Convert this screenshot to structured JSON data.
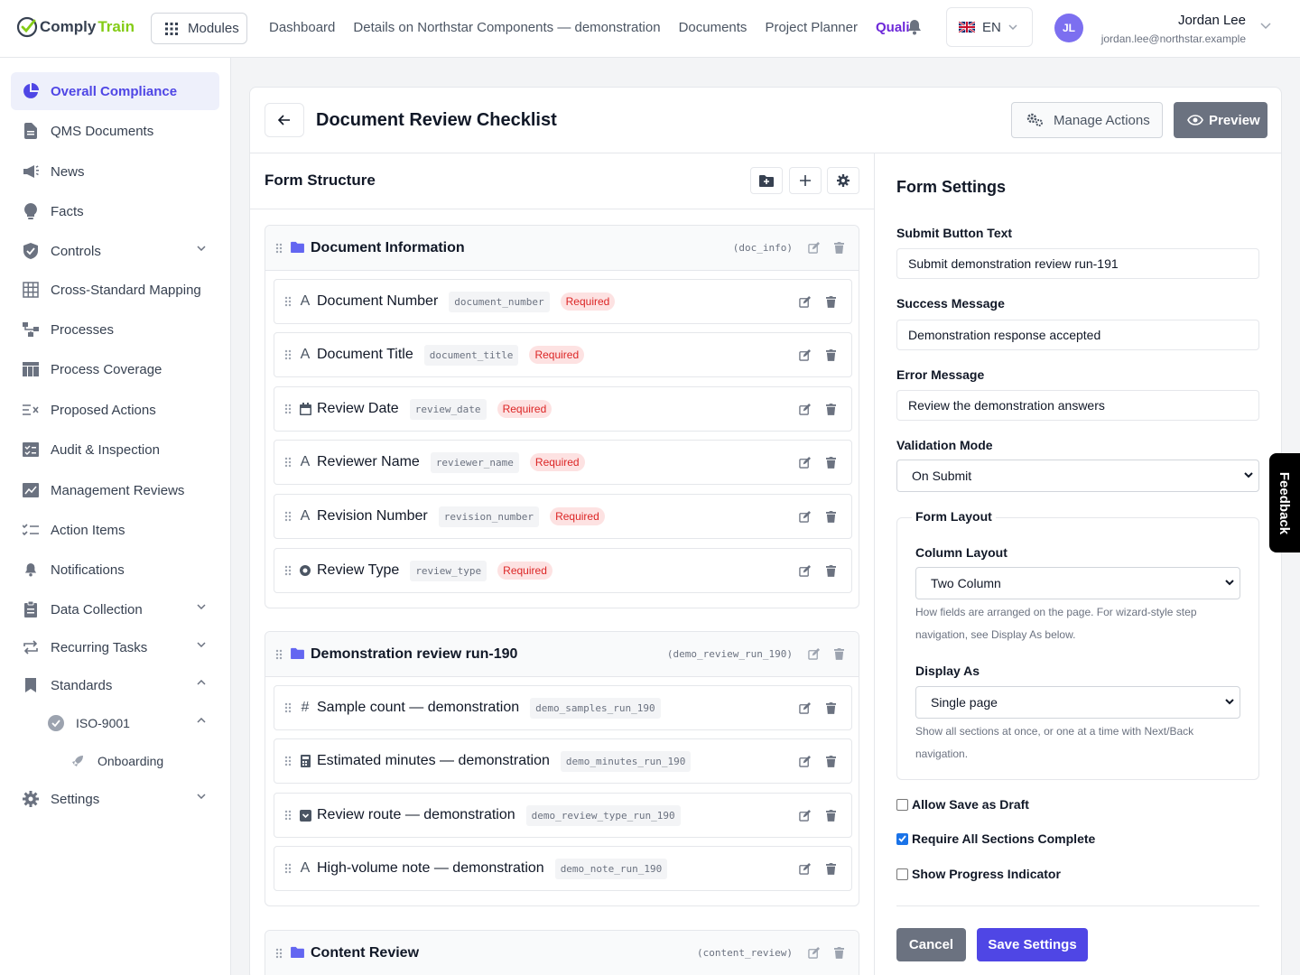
{
  "brand": {
    "name_part1": "Comply",
    "name_part2": "Train"
  },
  "topbar": {
    "modules_label": "Modules",
    "nav": [
      "Dashboard",
      "Details on Northstar Components — demonstration",
      "Documents",
      "Project Planner",
      "Quali"
    ],
    "language": "EN",
    "user": {
      "initials": "JL",
      "name": "Jordan Lee",
      "email": "jordan.lee@northstar.example"
    }
  },
  "sidebar": {
    "items": [
      {
        "label": "Overall Compliance",
        "icon": "pie-chart-icon"
      },
      {
        "label": "QMS Documents",
        "icon": "document-icon"
      },
      {
        "label": "News",
        "icon": "megaphone-icon"
      },
      {
        "label": "Facts",
        "icon": "lightbulb-icon"
      },
      {
        "label": "Controls",
        "icon": "shield-icon"
      },
      {
        "label": "Cross-Standard Mapping",
        "icon": "grid-icon"
      },
      {
        "label": "Processes",
        "icon": "process-icon"
      },
      {
        "label": "Process Coverage",
        "icon": "table-icon"
      },
      {
        "label": "Proposed Actions",
        "icon": "list-x-icon"
      },
      {
        "label": "Audit & Inspection",
        "icon": "checklist-icon"
      },
      {
        "label": "Management Reviews",
        "icon": "chart-icon"
      },
      {
        "label": "Action Items",
        "icon": "tasks-icon"
      },
      {
        "label": "Notifications",
        "icon": "bell-icon"
      },
      {
        "label": "Data Collection",
        "icon": "clipboard-icon"
      },
      {
        "label": "Recurring Tasks",
        "icon": "repeat-icon"
      },
      {
        "label": "Standards",
        "icon": "bookmark-icon"
      },
      {
        "label": "ISO-9001",
        "icon": "badge-icon"
      },
      {
        "label": "Onboarding",
        "icon": "rocket-icon"
      },
      {
        "label": "Settings",
        "icon": "gear-icon"
      }
    ]
  },
  "page": {
    "title": "Document Review Checklist",
    "manage_actions": "Manage Actions",
    "preview": "Preview"
  },
  "form_structure": {
    "title": "Form Structure",
    "sections": [
      {
        "title": "Document Information",
        "key": "(doc_info)",
        "fields": [
          {
            "label": "Document Number",
            "key": "document_number",
            "required": "Required",
            "type": "text"
          },
          {
            "label": "Document Title",
            "key": "document_title",
            "required": "Required",
            "type": "text"
          },
          {
            "label": "Review Date",
            "key": "review_date",
            "required": "Required",
            "type": "date"
          },
          {
            "label": "Reviewer Name",
            "key": "reviewer_name",
            "required": "Required",
            "type": "text"
          },
          {
            "label": "Revision Number",
            "key": "revision_number",
            "required": "Required",
            "type": "text"
          },
          {
            "label": "Review Type",
            "key": "review_type",
            "required": "Required",
            "type": "radio"
          }
        ]
      },
      {
        "title": "Demonstration review run-190",
        "key": "(demo_review_run_190)",
        "fields": [
          {
            "label": "Sample count — demonstration",
            "key": "demo_samples_run_190",
            "type": "number"
          },
          {
            "label": "Estimated minutes — demonstration",
            "key": "demo_minutes_run_190",
            "type": "calculator"
          },
          {
            "label": "Review route — demonstration",
            "key": "demo_review_type_run_190",
            "type": "select"
          },
          {
            "label": "High-volume note — demonstration",
            "key": "demo_note_run_190",
            "type": "text"
          }
        ]
      },
      {
        "title": "Content Review",
        "key": "(content_review)",
        "fields": []
      }
    ]
  },
  "form_settings": {
    "title": "Form Settings",
    "submit_label": "Submit Button Text",
    "submit_value": "Submit demonstration review run-191",
    "success_label": "Success Message",
    "success_value": "Demonstration response accepted",
    "error_label": "Error Message",
    "error_value": "Review the demonstration answers",
    "validation_label": "Validation Mode",
    "validation_value": "On Submit",
    "layout_legend": "Form Layout",
    "column_label": "Column Layout",
    "column_value": "Two Column",
    "column_help": "How fields are arranged on the page. For wizard-style step navigation, see Display As below.",
    "display_label": "Display As",
    "display_value": "Single page",
    "display_help": "Show all sections at once, or one at a time with Next/Back navigation.",
    "checks": [
      {
        "label": "Allow Save as Draft",
        "checked": false
      },
      {
        "label": "Require All Sections Complete",
        "checked": true
      },
      {
        "label": "Show Progress Indicator",
        "checked": false
      }
    ],
    "cancel": "Cancel",
    "save": "Save Settings"
  },
  "feedback": "Feedback",
  "colors": {
    "accent": "#4f46e5",
    "required_bg": "#fde2e2",
    "required_text": "#dc2626",
    "brand_green": "#84cc16"
  }
}
